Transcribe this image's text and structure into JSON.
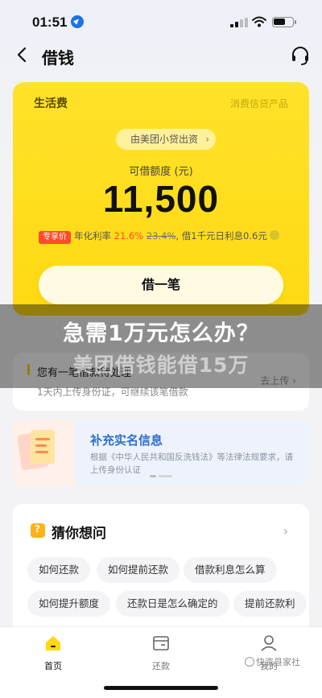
{
  "status_bar": {
    "time": "01:51"
  },
  "nav": {
    "title": "借钱"
  },
  "card": {
    "label": "生活费",
    "product_type": "消费信贷产品",
    "source": "由美团小贷出资",
    "source_chevron": "›",
    "quota_label": "可借额度 (元)",
    "amount": "11,500",
    "rate": {
      "tag": "专享价",
      "prefix": "年化利率",
      "rate": "21.6%",
      "old_rate": "23.4%",
      "suffix": ", 借1千元日利息0.6元"
    },
    "borrow_button": "借一笔"
  },
  "overlay": {
    "headline": "急需1万元怎么办？",
    "subline": "美团借钱能借15万"
  },
  "upload_card": {
    "title": "您有一笔借款待处理",
    "subtitle": "1天内上传身份证，可继续该笔借款",
    "link": "去上传 ›"
  },
  "realname_banner": {
    "title": "补充实名信息",
    "description": "根据《中华人民共和国反洗钱法》等法律法规要求，请上传身份认证"
  },
  "guess": {
    "title": "猜你想问",
    "chevron": "›",
    "chips": [
      "如何还款",
      "如何提前还款",
      "借款利息怎么算",
      "如何提升额度",
      "还款日是怎么确定的",
      "提前还款利"
    ]
  },
  "tabs": [
    {
      "label": "首页",
      "icon": "home-icon",
      "active": true
    },
    {
      "label": "还款",
      "icon": "repay-icon",
      "active": false
    },
    {
      "label": "我的",
      "icon": "profile-icon",
      "active": false
    }
  ],
  "watermark": "快资县家社",
  "colors": {
    "brand_yellow": "#ffd912",
    "accent_red": "#ff4b2b",
    "link_blue": "#2f6fcf"
  }
}
